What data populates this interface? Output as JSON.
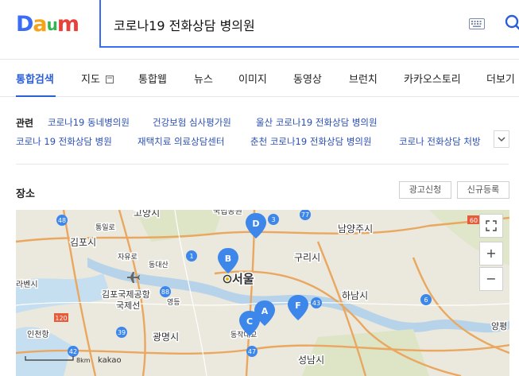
{
  "logo": {
    "text": "Daum",
    "letters": [
      "D",
      "a",
      "u",
      "m"
    ],
    "colors": [
      "#3b6cf6",
      "#f5a31a",
      "#2fb64e",
      "#e8403a"
    ]
  },
  "search": {
    "query": "코로나19 전화상담 병의원"
  },
  "tabs": [
    {
      "label": "통합검색",
      "active": true
    },
    {
      "label": "지도"
    },
    {
      "label": "통합웹"
    },
    {
      "label": "뉴스"
    },
    {
      "label": "이미지"
    },
    {
      "label": "동영상"
    },
    {
      "label": "브런치"
    },
    {
      "label": "카카오스토리"
    },
    {
      "label": "더보기"
    }
  ],
  "related": {
    "label": "관련",
    "row1": [
      "코로나19 동네병의원",
      "건강보험 심사평가원",
      "울산 코로나19 전화상담 병의원"
    ],
    "row2": [
      "코로나 19 전화상담 병원",
      "재택치료 의료상담센터",
      "춘천 코로나19 전화상담 병의원",
      "코로나 전화상담 처방"
    ]
  },
  "places": {
    "title": "장소",
    "ad_button": "광고신청",
    "register_button": "신규등록"
  },
  "map": {
    "cities": [
      "고양시",
      "김포시",
      "남양주시",
      "구리시",
      "서울",
      "하남시",
      "광명시",
      "성남시",
      "인천항",
      "라벤시",
      "김포국제공항",
      "국제선",
      "국립공원",
      "자유로",
      "통일로",
      "동대산",
      "영등",
      "동작대교",
      "양평"
    ],
    "route_numbers": [
      "48",
      "3",
      "1",
      "6",
      "43",
      "47",
      "39",
      "88",
      "120",
      "42",
      "60",
      "77"
    ],
    "markers": [
      "A",
      "B",
      "C",
      "D",
      "F"
    ],
    "scale": "8km",
    "brand": "kakao",
    "zoom_in": "+",
    "zoom_out": "−",
    "colors": {
      "marker": "#3d86ea",
      "route": "#e9a25a",
      "water": "#b7d3ea"
    }
  }
}
